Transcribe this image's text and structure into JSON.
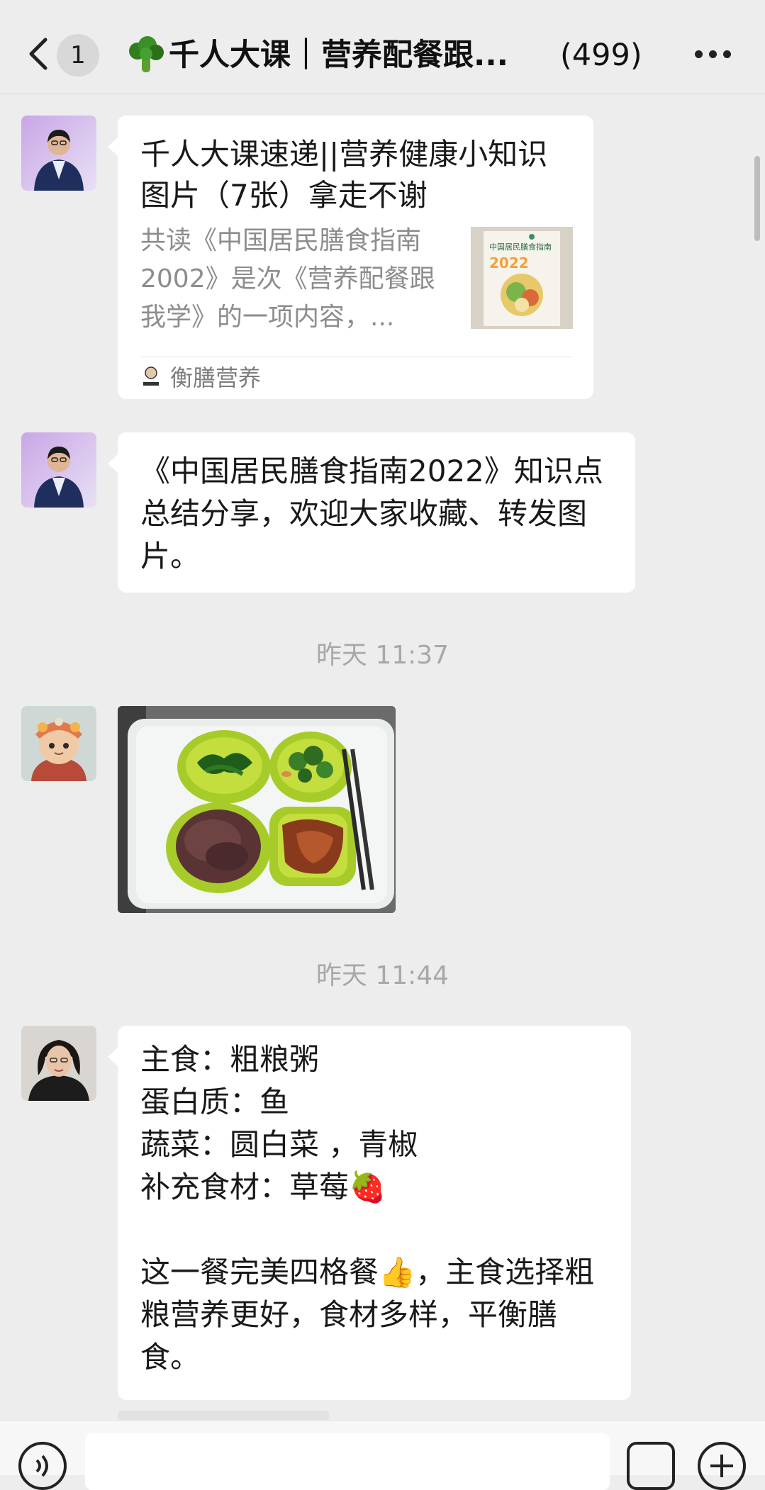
{
  "header": {
    "back_icon": "chevron-left-icon",
    "unread_count": "1",
    "title_icon": "broccoli-icon",
    "title": "千人大课｜营养配餐跟...",
    "member_count": "(499)",
    "more_icon": "more-dots-icon"
  },
  "messages": {
    "link_card": {
      "title": "千人大课速递||营养健康小知识图片（7张）拿走不谢",
      "description": "共读《中国居民膳食指南2002》是次《营养配餐跟我学》的一项内容，...",
      "thumb_book_title": "中国居民膳食指南",
      "thumb_year": "2022",
      "source": "衡膳营养"
    },
    "text_1": "《中国居民膳食指南2022》知识点总结分享，欢迎大家收藏、转发图片。",
    "timestamp_1": "昨天 11:37",
    "timestamp_2": "昨天 11:44",
    "text_2": "主食：粗粮粥\n蛋白质：鱼\n蔬菜：圆白菜 ，青椒\n补充食材：草莓🍓\n\n这一餐完美四格餐👍，主食选择粗粮营养更好，食材多样，平衡膳食。"
  },
  "input_bar": {
    "voice_icon": "voice-icon",
    "emoji_icon": "emoji-icon",
    "plus_icon": "plus-icon",
    "placeholder": ""
  },
  "colors": {
    "background": "#ededed",
    "bubble": "#ffffff",
    "timestamp": "#a8a8a8"
  }
}
